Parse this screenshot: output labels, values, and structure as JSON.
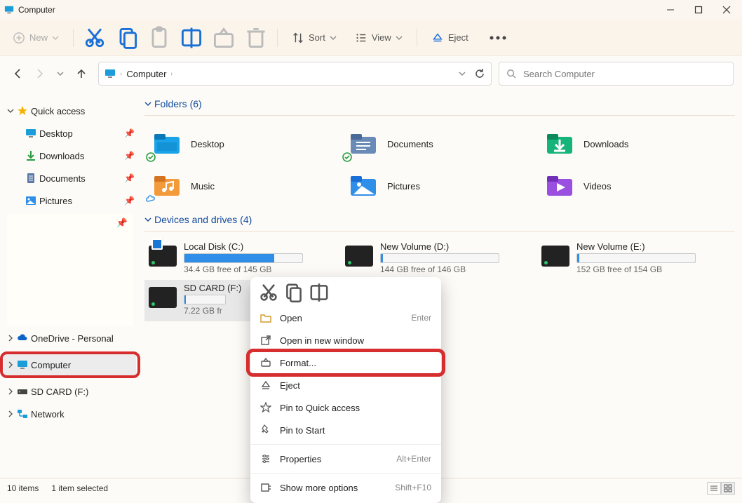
{
  "window": {
    "title": "Computer"
  },
  "toolbar": {
    "new_label": "New",
    "sort_label": "Sort",
    "view_label": "View",
    "eject_label": "Eject"
  },
  "breadcrumb": {
    "root": "Computer"
  },
  "search": {
    "placeholder": "Search Computer"
  },
  "sidebar": {
    "quick_access": "Quick access",
    "items": [
      {
        "label": "Desktop"
      },
      {
        "label": "Downloads"
      },
      {
        "label": "Documents"
      },
      {
        "label": "Pictures"
      }
    ],
    "onedrive": "OneDrive - Personal",
    "computer": "Computer",
    "sdcard": "SD CARD (F:)",
    "network": "Network"
  },
  "sections": {
    "folders_label": "Folders (6)",
    "drives_label": "Devices and drives (4)"
  },
  "folders": [
    {
      "name": "Desktop",
      "sync": "ok"
    },
    {
      "name": "Documents",
      "sync": "ok"
    },
    {
      "name": "Downloads",
      "sync": "none"
    },
    {
      "name": "Music",
      "sync": "cloud"
    },
    {
      "name": "Pictures",
      "sync": "none"
    },
    {
      "name": "Videos",
      "sync": "none"
    }
  ],
  "drives": [
    {
      "name": "Local Disk (C:)",
      "stat": "34.4 GB free of 145 GB",
      "fill_pct": 76
    },
    {
      "name": "New Volume (D:)",
      "stat": "144 GB free of 146 GB",
      "fill_pct": 2
    },
    {
      "name": "New Volume (E:)",
      "stat": "152 GB free of 154 GB",
      "fill_pct": 2
    },
    {
      "name": "SD CARD (F:)",
      "stat": "7.22 GB fr",
      "fill_pct": 3
    }
  ],
  "context_menu": {
    "open": "Open",
    "open_accel": "Enter",
    "open_new": "Open in new window",
    "format": "Format...",
    "eject": "Eject",
    "pin_qa": "Pin to Quick access",
    "pin_start": "Pin to Start",
    "properties": "Properties",
    "properties_accel": "Alt+Enter",
    "more": "Show more options",
    "more_accel": "Shift+F10"
  },
  "status": {
    "count": "10 items",
    "selected": "1 item selected"
  }
}
